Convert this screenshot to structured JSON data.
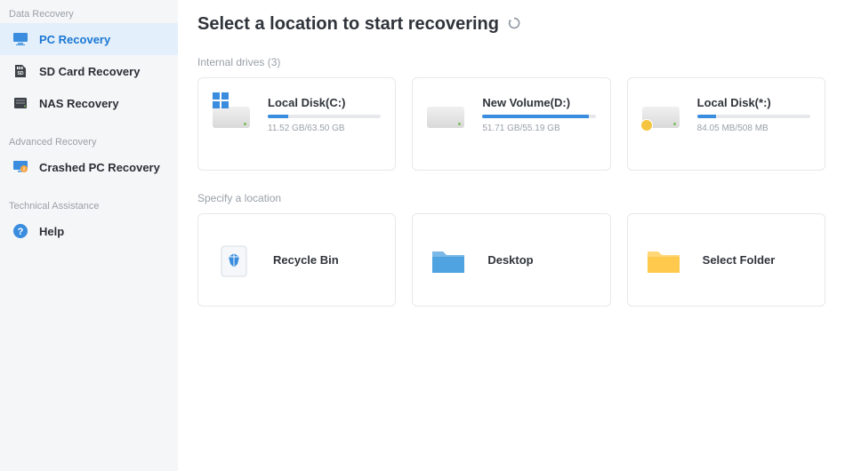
{
  "sidebar": {
    "sections": [
      {
        "label": "Data Recovery",
        "items": [
          {
            "label": "PC Recovery",
            "icon": "monitor",
            "active": true
          },
          {
            "label": "SD Card Recovery",
            "icon": "sd-card",
            "active": false
          },
          {
            "label": "NAS Recovery",
            "icon": "nas",
            "active": false
          }
        ]
      },
      {
        "label": "Advanced Recovery",
        "items": [
          {
            "label": "Crashed PC Recovery",
            "icon": "crashed-pc",
            "active": false
          }
        ]
      },
      {
        "label": "Technical Assistance",
        "items": [
          {
            "label": "Help",
            "icon": "help",
            "active": false
          }
        ]
      }
    ]
  },
  "main": {
    "title": "Select a location to start recovering",
    "internal_drives_label": "Internal drives (3)",
    "drives": [
      {
        "name": "Local Disk(C:)",
        "stats": "11.52 GB/63.50 GB",
        "fill_pct": 18,
        "overlay": "windows"
      },
      {
        "name": "New Volume(D:)",
        "stats": "51.71 GB/55.19 GB",
        "fill_pct": 94,
        "overlay": "none"
      },
      {
        "name": "Local Disk(*:)",
        "stats": "84.05 MB/508 MB",
        "fill_pct": 17,
        "overlay": "warning"
      }
    ],
    "specify_location_label": "Specify a location",
    "locations": [
      {
        "name": "Recycle Bin",
        "icon": "recycle-bin"
      },
      {
        "name": "Desktop",
        "icon": "desktop-folder"
      },
      {
        "name": "Select Folder",
        "icon": "select-folder"
      }
    ]
  }
}
